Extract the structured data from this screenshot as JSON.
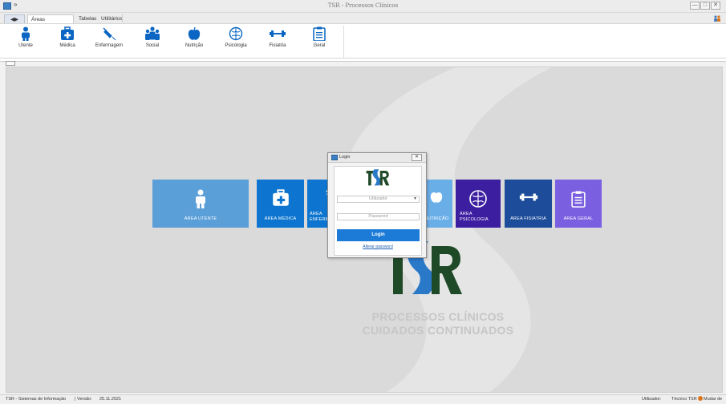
{
  "window": {
    "title": "TSR - Processos Clínicos",
    "quick_access": "»",
    "controls": [
      "✕",
      "—",
      "□"
    ]
  },
  "tabs": {
    "system": "◀▶",
    "items": [
      "Áreas Disponíveis",
      "Tabelas",
      "Utilitários"
    ]
  },
  "ribbon": {
    "items": [
      {
        "label": "Utente",
        "icon": "person-icon"
      },
      {
        "label": "Médica",
        "icon": "medical-kit-icon"
      },
      {
        "label": "Enfermagem",
        "icon": "syringe-icon"
      },
      {
        "label": "Social",
        "icon": "group-icon"
      },
      {
        "label": "Nutrição",
        "icon": "apple-icon"
      },
      {
        "label": "Psicologia",
        "icon": "brain-icon"
      },
      {
        "label": "Fisiatria",
        "icon": "dumbbell-icon"
      },
      {
        "label": "Geral",
        "icon": "clipboard-icon"
      }
    ],
    "accent": "#0a66c2"
  },
  "tiles": [
    {
      "label": "ÁREA UTENTE",
      "color": "#5b9fd8"
    },
    {
      "label": "ÁREA MÉDICA",
      "color": "#0d75cf"
    },
    {
      "label": "ÁREA\nENFERM",
      "color": "#0d75cf"
    },
    {
      "label": "NUTRIÇÃO",
      "color": "#6aaee8"
    },
    {
      "label": "ÁREA\nPSICOLOGIA",
      "color": "#3b1fa0"
    },
    {
      "label": "ÁREA FISIATRIA",
      "color": "#1c4c9a"
    },
    {
      "label": "ÁREA GERAL",
      "color": "#7a5fe0"
    }
  ],
  "brand": {
    "logo_text": "TSR",
    "line1": "PROCESSOS CLÍNICOS",
    "line2": "CUIDADOS CONTINUADOS",
    "dark_green": "#1f4a28",
    "blue": "#2a78c8"
  },
  "login": {
    "title": "Login",
    "close": "✕",
    "logo_text": "TSR",
    "user_placeholder": "Utilizador",
    "password_placeholder": "Password",
    "button": "Login",
    "link": "Alterar password"
  },
  "status": {
    "left": "TSR - Sistemas de Informação",
    "version_label": "| Versão:",
    "version": "25.11.2021",
    "user_label": "Utilizador:",
    "user": "Técnico TSR",
    "change": "Mudar de"
  }
}
